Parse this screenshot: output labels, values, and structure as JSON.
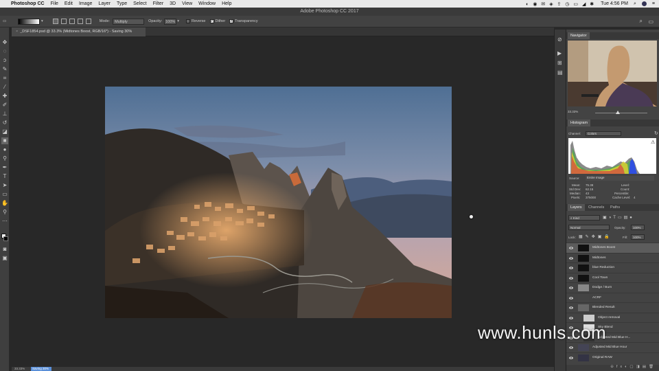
{
  "menubar": {
    "app_name": "Photoshop CC",
    "items": [
      "File",
      "Edit",
      "Image",
      "Layer",
      "Type",
      "Select",
      "Filter",
      "3D",
      "View",
      "Window",
      "Help"
    ],
    "clock": "Tue 4:56 PM"
  },
  "window_title": "Adobe Photoshop CC 2017",
  "options_bar": {
    "mode_label": "Mode:",
    "mode_value": "Multiply",
    "opacity_label": "Opacity:",
    "opacity_value": "100%",
    "reverse_label": "Reverse",
    "dither_label": "Dither",
    "transparency_label": "Transparency"
  },
  "document_tab": "_DSF1854.psd @ 33.3% (Midtones Boost, RGB/16*) - Saving 30%",
  "status": {
    "zoom": "33.33%",
    "saving": "Saving 30%"
  },
  "navigator": {
    "title": "Navigator",
    "zoom": "33.33%"
  },
  "histogram": {
    "title": "Histogram",
    "channel_label": "Channel:",
    "channel_value": "Colors",
    "source_label": "Source:",
    "source_value": "Entire Image",
    "stats": {
      "mean_label": "Mean:",
      "mean": "75.38",
      "std_label": "Std Dev:",
      "std": "62.15",
      "median_label": "Median:",
      "median": "43",
      "pixels_label": "Pixels:",
      "pixels": "375000",
      "level_label": "Level:",
      "count_label": "Count:",
      "percentile_label": "Percentile:",
      "cache_label": "Cache Level:",
      "cache": "4"
    }
  },
  "layers_panel": {
    "tabs": [
      "Layers",
      "Channels",
      "Paths"
    ],
    "kind_label": "Kind",
    "blend_mode": "Normal",
    "opacity_label": "Opacity:",
    "opacity_value": "100%",
    "lock_label": "Lock:",
    "fill_label": "Fill:",
    "fill_value": "100%",
    "layers": [
      {
        "name": "Midtones Boost",
        "indent": 0
      },
      {
        "name": "Midtones",
        "indent": 0
      },
      {
        "name": "blue Reduction",
        "indent": 0
      },
      {
        "name": "Cool Town",
        "indent": 0
      },
      {
        "name": "Dodge / Burn",
        "indent": 0
      },
      {
        "name": "ACRF",
        "indent": 0
      },
      {
        "name": "Blended Result",
        "indent": 0
      },
      {
        "name": "Object removal",
        "indent": 1
      },
      {
        "name": "Sky Blend",
        "indent": 1
      },
      {
        "name": "Adjusted Mid Blue H...",
        "indent": 1
      },
      {
        "name": "Adjusted Mid Blue Hour",
        "indent": 0
      },
      {
        "name": "Original RAW",
        "indent": 0
      }
    ]
  },
  "watermark": "www.hunls.com",
  "colors": {
    "accent": "#5a8fd8",
    "selected_layer": "#5c5c5c"
  }
}
